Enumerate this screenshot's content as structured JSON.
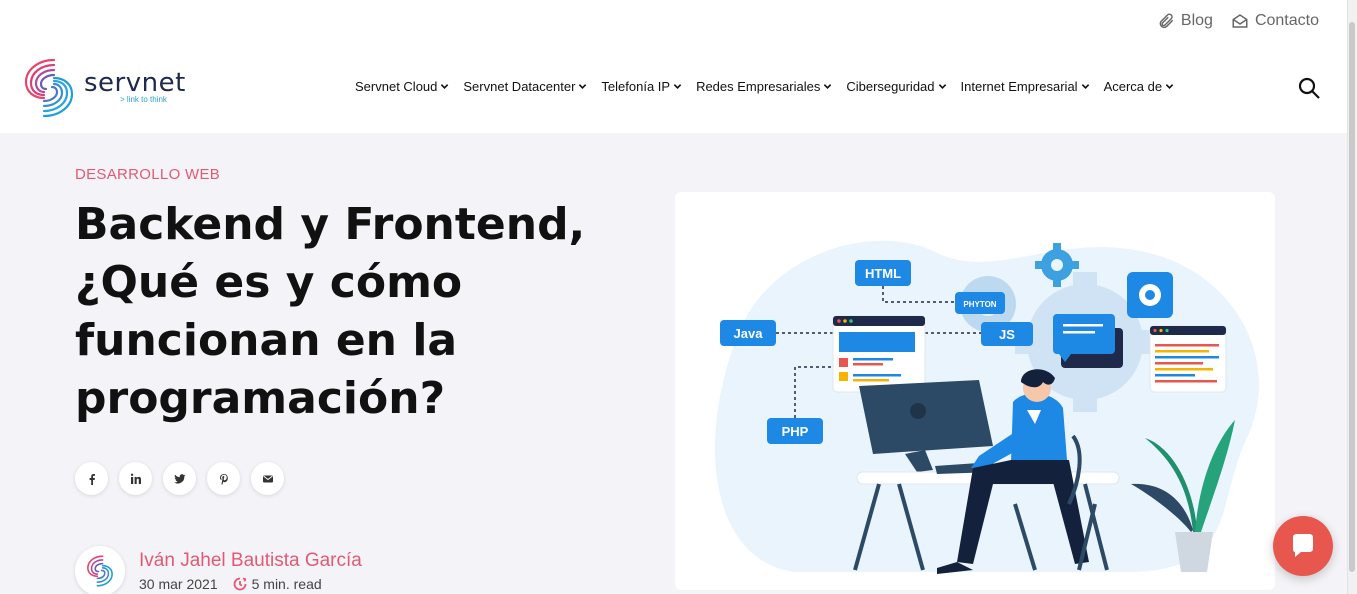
{
  "utility_links": [
    {
      "label": "Blog",
      "icon": "paperclip-icon"
    },
    {
      "label": "Contacto",
      "icon": "envelope-open-icon"
    }
  ],
  "logo": {
    "word": "servnet",
    "tagline": "> link to think"
  },
  "nav": {
    "items": [
      {
        "label": "Servnet Cloud"
      },
      {
        "label": "Servnet Datacenter"
      },
      {
        "label": "Telefonía IP"
      },
      {
        "label": "Redes Empresariales"
      },
      {
        "label": "Ciberseguridad"
      },
      {
        "label": "Internet Empresarial"
      },
      {
        "label": "Acerca de"
      }
    ],
    "search_icon": "search-icon"
  },
  "article": {
    "category": "DESARROLLO WEB",
    "title": "Backend y Frontend, ¿Qué es y cómo funcionan en la programación?",
    "share_icons": [
      "facebook-icon",
      "linkedin-icon",
      "twitter-icon",
      "pinterest-icon",
      "email-icon"
    ],
    "author": {
      "name": "Iván Jahel Bautista García",
      "date": "30 mar 2021",
      "read_time": "5 min. read"
    }
  },
  "illustration": {
    "labels": {
      "html": "HTML",
      "phyton": "PHYTON",
      "java": "Java",
      "js": "JS",
      "php": "PHP"
    }
  },
  "colors": {
    "accent": "#e05a74",
    "blue": "#1e88e5",
    "navy": "#1f2a4a",
    "chat": "#e8574e",
    "background": "#f4f4f8"
  }
}
